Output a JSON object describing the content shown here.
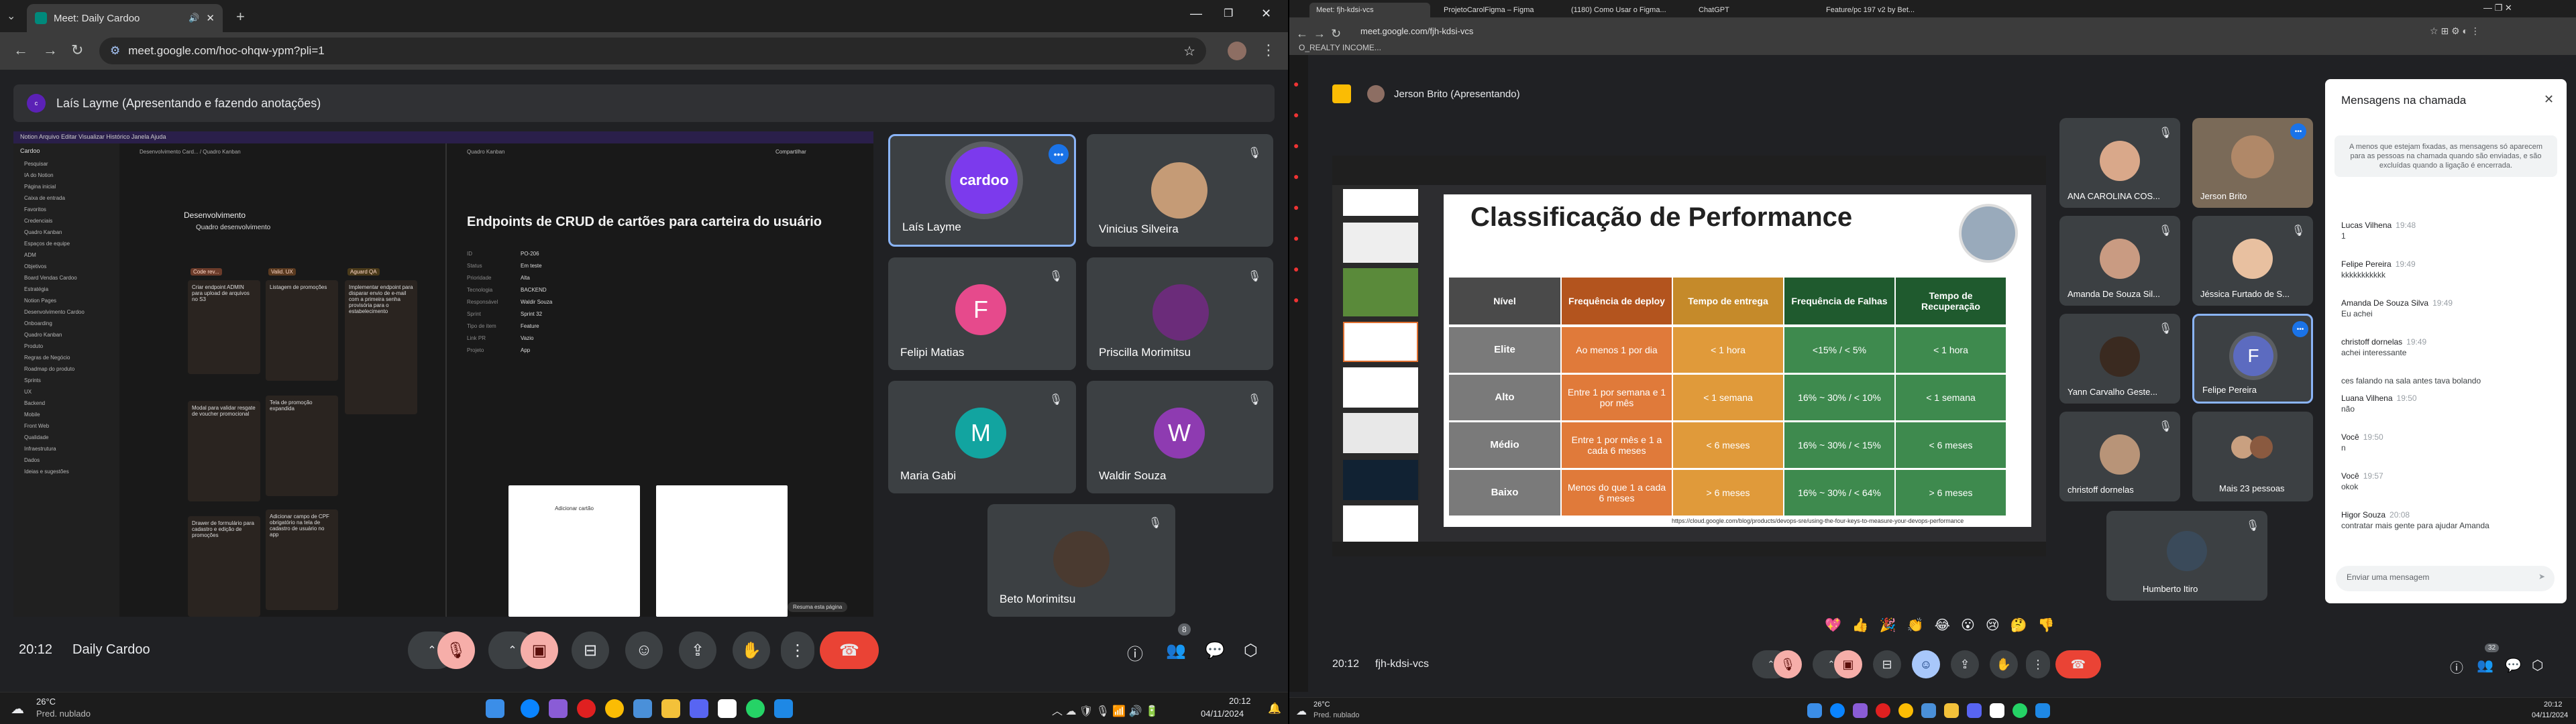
{
  "left": {
    "tab_title": "Meet: Daily Cardoo",
    "url": "meet.google.com/hoc-ohqw-ypm?pli=1",
    "presenter_banner": "Laís Layme (Apresentando e fazendo anotações)",
    "participants": [
      {
        "name": "Laís Layme",
        "avatar": "cardoo",
        "speaking": true
      },
      {
        "name": "Vinicius Silveira",
        "avatar": "photo"
      },
      {
        "name": "Felipi Matias",
        "initial": "F",
        "color": "#e64a8c"
      },
      {
        "name": "Priscilla Morimitsu",
        "avatar": "photo"
      },
      {
        "name": "Maria Gabi",
        "initial": "M",
        "color": "#12a4a0"
      },
      {
        "name": "Waldir Souza",
        "initial": "W",
        "color": "#8e3bb1"
      },
      {
        "name": "Beto Morimitsu",
        "avatar": "photo"
      }
    ],
    "time": "20:12",
    "meeting_name": "Daily Cardoo",
    "people_count": "8",
    "shared": {
      "workspace": "Cardoo",
      "board_title": "Quadro Kanban",
      "breadcrumb": "Desenvolvimento Card... / Quadro Kanban",
      "share_label": "Compartilhar",
      "section": "Desenvolvimento",
      "subsection": "Quadro desenvolvimento",
      "columns": [
        "Code rev...",
        "Valid. UX",
        "Aguard QA"
      ],
      "cards": [
        "Criar endpoint ADMIN para upload de arquivos no S3",
        "Modal para validar resgate de voucher promocional",
        "Drawer de formulário para cadastro e edição de promoções",
        "Listagem de promoções",
        "Tela de promoção expandida",
        "Adicionar campo de CPF obrigatório na tela de cadastro de usuário no app",
        "Implementar endpoint para disparar envio de e-mail com a primeira senha provisória para o estabelecimento"
      ],
      "doc_title": "Endpoints de CRUD de cartões para carteira do usuário",
      "props": [
        {
          "k": "ID",
          "v": "PO-206"
        },
        {
          "k": "Status",
          "v": "Em teste"
        },
        {
          "k": "Prioridade",
          "v": "Alta"
        },
        {
          "k": "Tecnologia",
          "v": "BACKEND"
        },
        {
          "k": "Responsável",
          "v": "Waldir Souza"
        },
        {
          "k": "Sprint",
          "v": "Sprint 32"
        },
        {
          "k": "Tipo de item",
          "v": "Feature"
        },
        {
          "k": "Link PR",
          "v": "Vazio"
        },
        {
          "k": "Projeto",
          "v": "App"
        }
      ],
      "sidebar": [
        "Pesquisar",
        "IA do Notion",
        "Página inicial",
        "Caixa de entrada",
        "Favoritos",
        "Credenciais",
        "Quadro Kanban",
        "Espaços de equipe",
        "ADM",
        "Objetivos",
        "Board Vendas Cardoo",
        "Estratégia",
        "Notion Pages",
        "Desenvolvimento Cardoo",
        "Onboarding",
        "Quadro Kanban",
        "Produto",
        "Regras de Negócio",
        "Roadmap do produto",
        "Sprints",
        "UX",
        "Backend",
        "Mobile",
        "Front Web",
        "Qualidade",
        "Infraestrutura",
        "Dados",
        "Ideias e sugestões"
      ],
      "mobile_caption": "Adicionar cartão",
      "resume_label": "Resuma esta página"
    }
  },
  "right": {
    "tabs": [
      "Meet: fjh-kdsi-vcs",
      "ProjetoCarolFigma – Figma",
      "(1180) Como Usar o Figma...",
      "ChatGPT",
      "Feature/pc 197 v2 by Bet..."
    ],
    "url": "meet.google.com/fjh-kdsi-vcs",
    "bookmark": "O_REALTY INCOME...",
    "presenter_banner": "Jerson Brito (Apresentando)",
    "slide": {
      "title": "Classificação de Performance",
      "col_headers": [
        "Nível",
        "Frequência de deploy",
        "Tempo de entrega",
        "Frequência de Falhas",
        "Tempo de Recuperação"
      ],
      "rows": [
        [
          "Elite",
          "Ao menos 1 por dia",
          "< 1 hora",
          "<15% / < 5%",
          "< 1 hora"
        ],
        [
          "Alto",
          "Entre 1 por semana e 1 por mês",
          "< 1 semana",
          "16% ~ 30% / < 10%",
          "< 1 semana"
        ],
        [
          "Médio",
          "Entre 1 por mês e 1 a cada 6 meses",
          "< 6 meses",
          "16% ~ 30% / < 15%",
          "< 6 meses"
        ],
        [
          "Baixo",
          "Menos do que 1 a cada 6 meses",
          "> 6 meses",
          "16% ~ 30% / < 64%",
          "> 6 meses"
        ]
      ],
      "source": "https://cloud.google.com/blog/products/devops-sre/using-the-four-keys-to-measure-your-devops-performance"
    },
    "participants": [
      {
        "name": "ANA CAROLINA COS...",
        "avatar": "photo"
      },
      {
        "name": "Jerson Brito",
        "avatar": "photo",
        "speaking": true
      },
      {
        "name": "Amanda De Souza Sil...",
        "avatar": "photo"
      },
      {
        "name": "Jéssica Furtado de S...",
        "avatar": "photo"
      },
      {
        "name": "Yann Carvalho Geste...",
        "avatar": "photo"
      },
      {
        "name": "Felipe Pereira",
        "initial": "F",
        "color": "#5c6bc0",
        "speaking": true
      },
      {
        "name": "christoff dornelas",
        "avatar": "photo"
      },
      {
        "name": "Mais 23 pessoas",
        "avatar": "group"
      },
      {
        "name": "Humberto Itiro",
        "avatar": "photo"
      }
    ],
    "chat": {
      "title": "Mensagens na chamada",
      "notice": "A menos que estejam fixadas, as mensagens só aparecem para as pessoas na chamada quando são enviadas, e são excluídas quando a ligação é encerrada.",
      "messages": [
        {
          "author": "Lucas Vilhena",
          "time": "19:48",
          "text": "1"
        },
        {
          "author": "Felipe Pereira",
          "time": "19:49",
          "text": "kkkkkkkkkkk"
        },
        {
          "author": "Amanda De Souza Silva",
          "time": "19:49",
          "text": "Eu achei"
        },
        {
          "author": "christoff dornelas",
          "time": "19:49",
          "text": "achei interessante"
        },
        {
          "author": "",
          "time": "",
          "text": "ces falando na sala antes tava bolando"
        },
        {
          "author": "Luana Vilhena",
          "time": "19:50",
          "text": "não"
        },
        {
          "author": "Você",
          "time": "19:50",
          "text": "n"
        },
        {
          "author": "Você",
          "time": "19:57",
          "text": "okok"
        },
        {
          "author": "Higor Souza",
          "time": "20:08",
          "text": "contratar mais gente para ajudar Amanda"
        }
      ],
      "input_placeholder": "Enviar uma mensagem"
    },
    "reactions": [
      "💖",
      "👍",
      "🎉",
      "👏",
      "😂",
      "😮",
      "😢",
      "🤔",
      "👎"
    ],
    "time": "20:12",
    "meeting_name": "fjh-kdsi-vcs",
    "people_count": "32"
  },
  "taskbar_left": {
    "temp": "26°C",
    "weather": "Pred. nublado",
    "time": "20:12",
    "date": "04/11/2024"
  },
  "taskbar_right": {
    "temp": "26°C",
    "weather": "Pred. nublado",
    "time": "20:12",
    "date": "04/11/2024"
  }
}
